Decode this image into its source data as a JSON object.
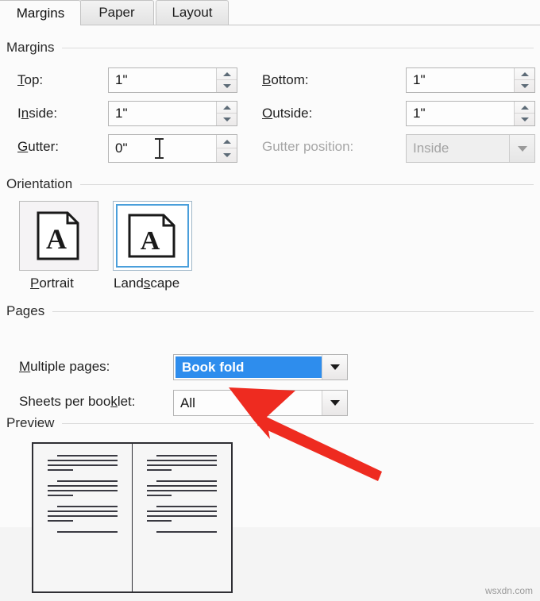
{
  "dialog": {
    "tabs": [
      {
        "label": "Margins",
        "active": true
      },
      {
        "label": "Paper",
        "active": false
      },
      {
        "label": "Layout",
        "active": false
      }
    ]
  },
  "margins_group": {
    "title": "Margins",
    "fields": {
      "top": {
        "label_before": "T",
        "label_acc": "",
        "label": "Top:",
        "value": "1\""
      },
      "inside": {
        "label": "Inside:",
        "value": "1\""
      },
      "gutter": {
        "label": "Gutter:",
        "value": "0\""
      },
      "bottom": {
        "label": "Bottom:",
        "value": "1\""
      },
      "outside": {
        "label": "Outside:",
        "value": "1\""
      },
      "gutter_position": {
        "label": "Gutter position:",
        "value": "Inside",
        "disabled": "true"
      }
    },
    "labels": {
      "top_a": "T",
      "top_b": "op:",
      "inside_a": "I",
      "inside_b": "n",
      "inside_c": "side:",
      "gutter_a": "G",
      "gutter_b": "utter:",
      "bottom_a": "B",
      "bottom_b": "ottom:",
      "outside_a": "O",
      "outside_b": "utside:",
      "gutterpos": "Gutter position:"
    }
  },
  "orientation_group": {
    "title": "Orientation",
    "portrait": {
      "label_a": "P",
      "label_b": "ortrait",
      "glyph": "A",
      "selected": "false"
    },
    "landscape": {
      "label_a": "Land",
      "label_b": "s",
      "label_c": "cape",
      "glyph": "A",
      "selected": "true"
    }
  },
  "pages_group": {
    "title": "Pages",
    "multiple_pages": {
      "label_a": "M",
      "label_b": "u",
      "label_c": "ltiple pages:",
      "value": "Book fold",
      "selected_highlight": "#2e8ded"
    },
    "sheets_per_booklet": {
      "label_a": "Sheets per boo",
      "label_b": "k",
      "label_c": "let:",
      "value": "All"
    }
  },
  "preview_group": {
    "title": "Preview",
    "pages": 2
  },
  "annotation": {
    "arrow_color": "#ee2b20",
    "arrow_direction": "up-left",
    "points_at": "sheets-per-booklet-combo"
  },
  "watermark": {
    "text": "wsxdn.com"
  },
  "icons": {
    "spinner_up": "triangle-up-icon",
    "spinner_down": "triangle-down-icon",
    "combo_arrow": "chevron-down-icon",
    "text_cursor": "i-beam-cursor-icon",
    "page_glyph": "page-a-icon"
  }
}
